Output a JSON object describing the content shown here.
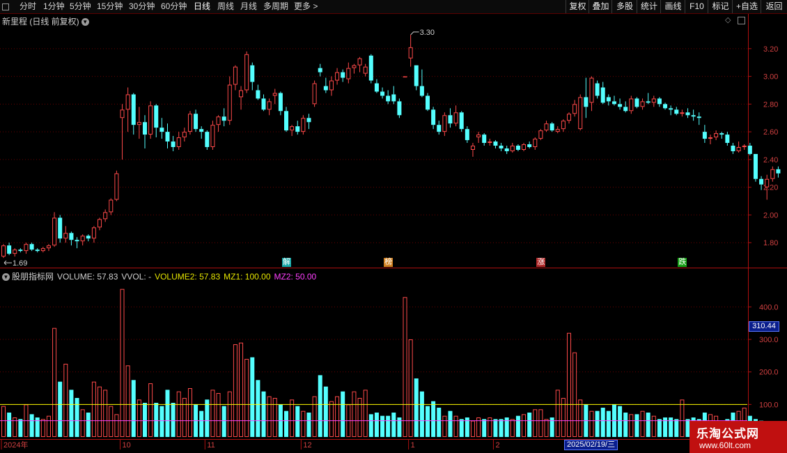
{
  "toolbar": {
    "items": [
      "分时",
      "1分钟",
      "5分钟",
      "15分钟",
      "30分钟",
      "60分钟",
      "日线",
      "周线",
      "月线",
      "多周期",
      "更多 >"
    ],
    "active": "日线",
    "right_items": [
      "复权",
      "叠加",
      "多股",
      "统计",
      "画线",
      "F10",
      "标记",
      "+自选",
      "返回"
    ]
  },
  "chart": {
    "title": "新里程 (日线 前复权)",
    "price_axis": {
      "min": 1.62,
      "max": 3.36,
      "ticks": [
        "3.20",
        "3.00",
        "2.80",
        "2.60",
        "2.40",
        "2.20",
        "2.00",
        "1.80"
      ]
    },
    "high_label": "3.30",
    "low_label": "1.69",
    "signals": [
      {
        "text": "解",
        "color": "#18a8a8",
        "bar": 50
      },
      {
        "text": "榜",
        "color": "#d08020",
        "bar": 68
      },
      {
        "text": "涨",
        "color": "#b02828",
        "bar": 95
      },
      {
        "text": "跌",
        "color": "#18a018",
        "bar": 120
      }
    ]
  },
  "indicator": {
    "title": "股朋指标网",
    "volume_label": "VOLUME: 57.83",
    "vvol_label": "VVOL: -",
    "volume2_label": "VOLUME2: 57.83",
    "mz1_label": "MZ1: 100.00",
    "mz2_label": "MZ2: 50.00",
    "axis": {
      "max": 480,
      "ticks": [
        "400.0",
        "300.0",
        "200.0",
        "100.0"
      ]
    },
    "mz1": 100,
    "mz2": 50
  },
  "cursor_value": "310.44",
  "cursor_date": "2025/02/19/三",
  "date_labels": [
    {
      "text": "2024年",
      "bar": 0
    },
    {
      "text": "10",
      "bar": 21
    },
    {
      "text": "11",
      "bar": 36
    },
    {
      "text": "12",
      "bar": 53
    },
    {
      "text": "1",
      "bar": 72
    },
    {
      "text": "2",
      "bar": 87
    }
  ],
  "watermark": {
    "line1": "乐淘公式网",
    "line2": "www.60lt.com"
  },
  "colors": {
    "up": "#ff4a4a",
    "down": "#54ffff",
    "grid": "#6a0000",
    "mz1": "#ffff00",
    "mz2": "#ff40ff"
  },
  "chart_data": {
    "type": "candlestick",
    "candles_ohlc": [
      [
        1.7,
        1.79,
        1.69,
        1.78
      ],
      [
        1.78,
        1.8,
        1.71,
        1.72
      ],
      [
        1.72,
        1.76,
        1.7,
        1.75
      ],
      [
        1.75,
        1.76,
        1.73,
        1.74
      ],
      [
        1.74,
        1.8,
        1.72,
        1.79
      ],
      [
        1.79,
        1.8,
        1.74,
        1.75
      ],
      [
        1.75,
        1.76,
        1.73,
        1.74
      ],
      [
        1.74,
        1.77,
        1.73,
        1.76
      ],
      [
        1.76,
        1.79,
        1.74,
        1.78
      ],
      [
        1.78,
        2.02,
        1.77,
        1.98
      ],
      [
        1.98,
        2.0,
        1.8,
        1.83
      ],
      [
        1.83,
        1.92,
        1.8,
        1.87
      ],
      [
        1.87,
        1.88,
        1.78,
        1.82
      ],
      [
        1.82,
        1.84,
        1.76,
        1.81
      ],
      [
        1.81,
        1.86,
        1.78,
        1.85
      ],
      [
        1.85,
        1.86,
        1.81,
        1.83
      ],
      [
        1.83,
        1.92,
        1.8,
        1.91
      ],
      [
        1.91,
        1.98,
        1.89,
        1.97
      ],
      [
        1.97,
        2.04,
        1.95,
        2.02
      ],
      [
        2.02,
        2.12,
        2.0,
        2.11
      ],
      [
        2.11,
        2.32,
        2.1,
        2.3
      ],
      [
        2.7,
        2.8,
        2.4,
        2.76
      ],
      [
        2.76,
        2.92,
        2.6,
        2.87
      ],
      [
        2.87,
        2.88,
        2.58,
        2.65
      ],
      [
        2.65,
        2.78,
        2.55,
        2.67
      ],
      [
        2.67,
        2.72,
        2.48,
        2.58
      ],
      [
        2.58,
        2.82,
        2.55,
        2.79
      ],
      [
        2.79,
        2.8,
        2.56,
        2.63
      ],
      [
        2.63,
        2.7,
        2.55,
        2.6
      ],
      [
        2.6,
        2.66,
        2.48,
        2.53
      ],
      [
        2.53,
        2.57,
        2.46,
        2.49
      ],
      [
        2.49,
        2.6,
        2.47,
        2.56
      ],
      [
        2.56,
        2.63,
        2.53,
        2.6
      ],
      [
        2.6,
        2.75,
        2.58,
        2.73
      ],
      [
        2.73,
        2.76,
        2.6,
        2.62
      ],
      [
        2.62,
        2.64,
        2.55,
        2.6
      ],
      [
        2.6,
        2.61,
        2.47,
        2.49
      ],
      [
        2.49,
        2.68,
        2.47,
        2.65
      ],
      [
        2.65,
        2.72,
        2.6,
        2.71
      ],
      [
        2.71,
        2.77,
        2.64,
        2.68
      ],
      [
        2.68,
        3.0,
        2.65,
        2.94
      ],
      [
        2.94,
        3.08,
        2.9,
        3.07
      ],
      [
        2.85,
        2.93,
        2.76,
        2.9
      ],
      [
        2.9,
        3.18,
        2.88,
        3.16
      ],
      [
        3.08,
        3.1,
        2.9,
        2.96
      ],
      [
        2.9,
        2.94,
        2.83,
        2.84
      ],
      [
        2.84,
        2.87,
        2.75,
        2.76
      ],
      [
        2.76,
        2.84,
        2.72,
        2.82
      ],
      [
        2.86,
        2.91,
        2.8,
        2.88
      ],
      [
        2.88,
        2.89,
        2.72,
        2.75
      ],
      [
        2.75,
        2.78,
        2.6,
        2.61
      ],
      [
        2.61,
        2.65,
        2.57,
        2.64
      ],
      [
        2.64,
        2.68,
        2.58,
        2.6
      ],
      [
        2.6,
        2.72,
        2.58,
        2.7
      ],
      [
        2.7,
        2.73,
        2.62,
        2.67
      ],
      [
        2.8,
        2.97,
        2.78,
        2.95
      ],
      [
        3.06,
        3.09,
        3.0,
        3.03
      ],
      [
        2.93,
        2.99,
        2.88,
        2.9
      ],
      [
        2.9,
        3.0,
        2.86,
        2.97
      ],
      [
        2.97,
        3.06,
        2.94,
        3.03
      ],
      [
        3.03,
        3.05,
        2.96,
        2.99
      ],
      [
        2.98,
        3.1,
        2.95,
        3.06
      ],
      [
        3.06,
        3.09,
        3.02,
        3.08
      ],
      [
        3.08,
        3.14,
        3.03,
        3.13
      ],
      [
        3.02,
        3.09,
        3.0,
        3.07
      ],
      [
        3.15,
        3.16,
        2.95,
        2.97
      ],
      [
        2.95,
        2.98,
        2.88,
        2.89
      ],
      [
        2.89,
        2.92,
        2.84,
        2.86
      ],
      [
        2.86,
        2.9,
        2.8,
        2.82
      ],
      [
        2.87,
        2.93,
        2.8,
        2.82
      ],
      [
        2.82,
        2.84,
        2.7,
        2.72
      ],
      [
        3.0,
        3.0,
        3.0,
        3.0
      ],
      [
        3.13,
        3.3,
        3.07,
        3.21
      ],
      [
        3.08,
        3.08,
        2.9,
        2.93
      ],
      [
        2.93,
        3.05,
        2.85,
        2.86
      ],
      [
        2.86,
        2.88,
        2.75,
        2.76
      ],
      [
        2.76,
        2.78,
        2.62,
        2.65
      ],
      [
        2.65,
        2.68,
        2.58,
        2.6
      ],
      [
        2.6,
        2.74,
        2.57,
        2.72
      ],
      [
        2.72,
        2.77,
        2.63,
        2.66
      ],
      [
        2.66,
        2.79,
        2.64,
        2.74
      ],
      [
        2.74,
        2.75,
        2.6,
        2.62
      ],
      [
        2.62,
        2.64,
        2.52,
        2.54
      ],
      [
        2.47,
        2.52,
        2.42,
        2.5
      ],
      [
        2.56,
        2.6,
        2.52,
        2.58
      ],
      [
        2.58,
        2.59,
        2.5,
        2.52
      ],
      [
        2.52,
        2.55,
        2.5,
        2.53
      ],
      [
        2.53,
        2.54,
        2.48,
        2.5
      ],
      [
        2.5,
        2.52,
        2.46,
        2.48
      ],
      [
        2.48,
        2.5,
        2.44,
        2.46
      ],
      [
        2.46,
        2.52,
        2.45,
        2.5
      ],
      [
        2.5,
        2.51,
        2.46,
        2.47
      ],
      [
        2.47,
        2.52,
        2.46,
        2.51
      ],
      [
        2.51,
        2.53,
        2.48,
        2.49
      ],
      [
        2.49,
        2.56,
        2.47,
        2.55
      ],
      [
        2.55,
        2.62,
        2.54,
        2.61
      ],
      [
        2.61,
        2.68,
        2.6,
        2.66
      ],
      [
        2.66,
        2.67,
        2.6,
        2.61
      ],
      [
        2.6,
        2.64,
        2.59,
        2.62
      ],
      [
        2.62,
        2.69,
        2.6,
        2.68
      ],
      [
        2.68,
        2.74,
        2.66,
        2.73
      ],
      [
        2.73,
        2.83,
        2.71,
        2.8
      ],
      [
        2.62,
        2.87,
        2.61,
        2.85
      ],
      [
        2.85,
        2.99,
        2.7,
        2.78
      ],
      [
        2.81,
        3.0,
        2.75,
        2.99
      ],
      [
        2.95,
        2.97,
        2.84,
        2.86
      ],
      [
        2.92,
        2.96,
        2.8,
        2.81
      ],
      [
        2.85,
        2.87,
        2.79,
        2.82
      ],
      [
        2.82,
        2.86,
        2.79,
        2.8
      ],
      [
        2.8,
        2.84,
        2.76,
        2.78
      ],
      [
        2.78,
        2.82,
        2.74,
        2.75
      ],
      [
        2.75,
        2.86,
        2.73,
        2.84
      ],
      [
        2.84,
        2.85,
        2.77,
        2.78
      ],
      [
        2.78,
        2.84,
        2.76,
        2.82
      ],
      [
        2.82,
        2.88,
        2.8,
        2.81
      ],
      [
        2.81,
        2.86,
        2.78,
        2.84
      ],
      [
        2.84,
        2.85,
        2.78,
        2.8
      ],
      [
        2.8,
        2.81,
        2.76,
        2.77
      ],
      [
        2.77,
        2.79,
        2.72,
        2.76
      ],
      [
        2.76,
        2.78,
        2.72,
        2.73
      ],
      [
        2.73,
        2.76,
        2.71,
        2.74
      ],
      [
        2.74,
        2.77,
        2.7,
        2.72
      ],
      [
        2.72,
        2.76,
        2.68,
        2.71
      ],
      [
        2.71,
        2.74,
        2.65,
        2.7
      ],
      [
        2.6,
        2.65,
        2.52,
        2.55
      ],
      [
        2.55,
        2.58,
        2.51,
        2.56
      ],
      [
        2.56,
        2.61,
        2.54,
        2.59
      ],
      [
        2.59,
        2.6,
        2.55,
        2.58
      ],
      [
        2.58,
        2.6,
        2.5,
        2.52
      ],
      [
        2.5,
        2.52,
        2.44,
        2.46
      ],
      [
        2.46,
        2.53,
        2.45,
        2.49
      ],
      [
        2.49,
        2.51,
        2.47,
        2.5
      ],
      [
        2.5,
        2.52,
        2.43,
        2.44
      ],
      [
        2.44,
        2.44,
        2.24,
        2.26
      ],
      [
        2.26,
        2.28,
        2.18,
        2.22
      ],
      [
        2.2,
        2.29,
        2.11,
        2.26
      ],
      [
        2.26,
        2.35,
        2.24,
        2.33
      ],
      [
        2.33,
        2.35,
        2.27,
        2.3
      ]
    ],
    "volumes": [
      95,
      75,
      60,
      55,
      100,
      70,
      60,
      55,
      65,
      335,
      170,
      225,
      145,
      120,
      85,
      75,
      170,
      155,
      145,
      95,
      70,
      455,
      220,
      175,
      115,
      105,
      165,
      105,
      95,
      145,
      105,
      140,
      120,
      150,
      100,
      80,
      115,
      145,
      135,
      95,
      140,
      285,
      290,
      240,
      245,
      175,
      140,
      125,
      120,
      100,
      80,
      115,
      95,
      80,
      75,
      125,
      190,
      155,
      110,
      125,
      140,
      100,
      140,
      120,
      145,
      70,
      75,
      65,
      65,
      75,
      60,
      430,
      300,
      180,
      140,
      95,
      110,
      90,
      65,
      80,
      65,
      55,
      60,
      50,
      60,
      55,
      60,
      55,
      55,
      60,
      55,
      65,
      70,
      75,
      85,
      85,
      55,
      60,
      145,
      120,
      320,
      260,
      115,
      100,
      80,
      80,
      90,
      80,
      100,
      95,
      75,
      70,
      70,
      80,
      75,
      65,
      55,
      60,
      60,
      55,
      115,
      55,
      60,
      55,
      75,
      70,
      65,
      50,
      55,
      75,
      80,
      90,
      65,
      55,
      50
    ]
  }
}
